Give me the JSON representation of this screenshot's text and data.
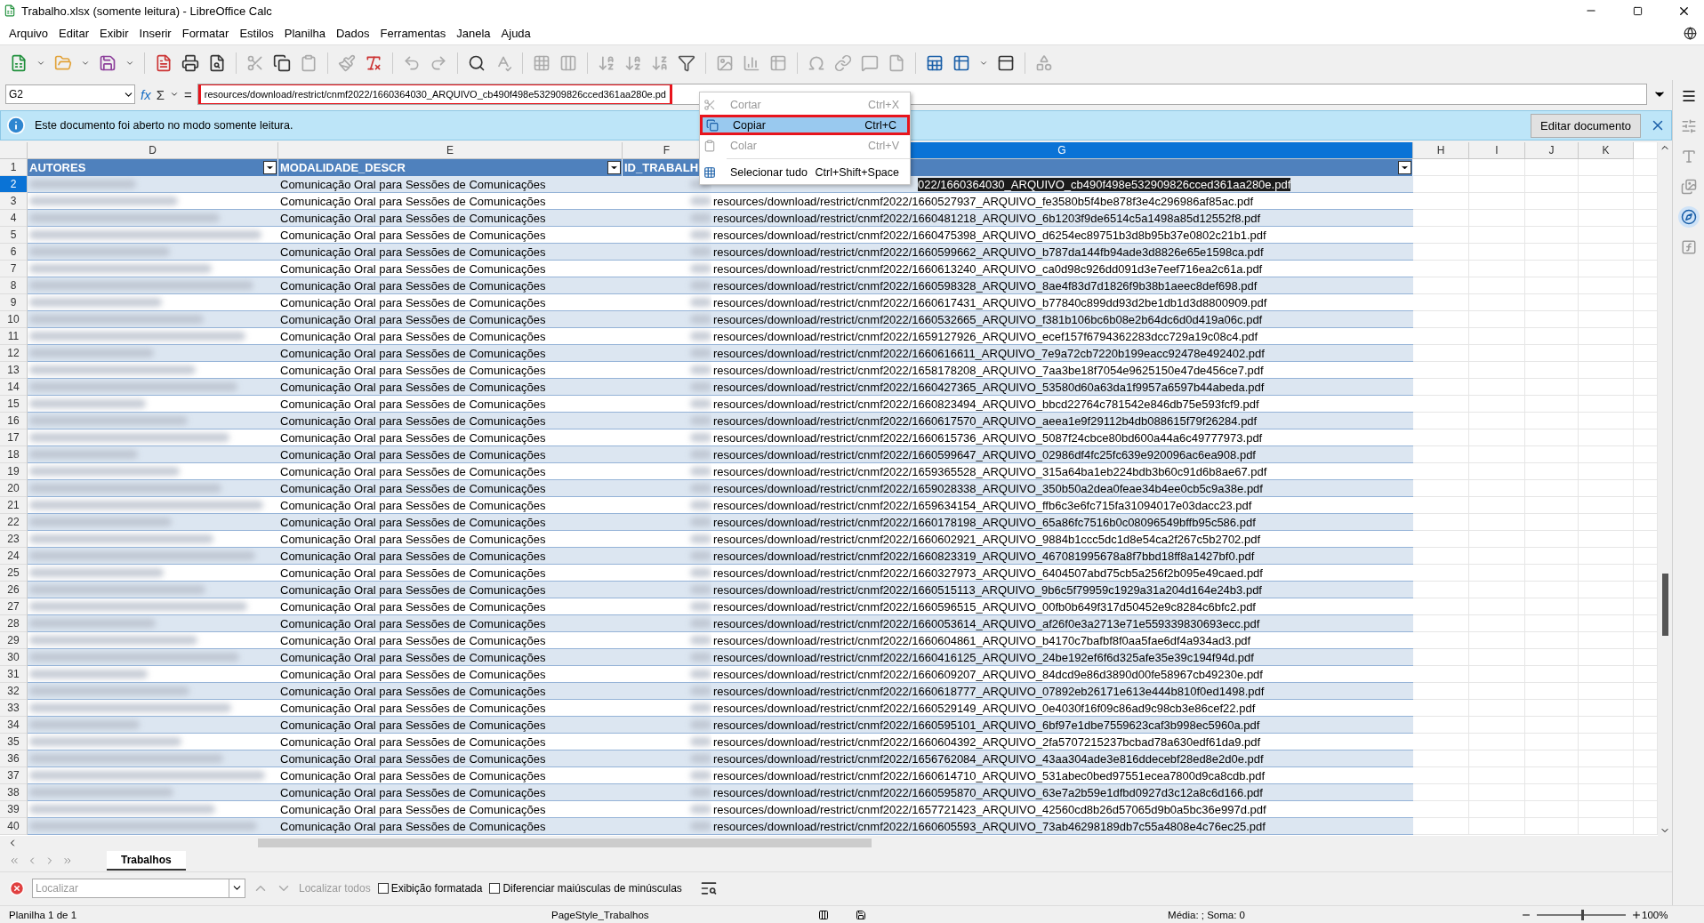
{
  "window": {
    "title": "Trabalho.xlsx (somente leitura) - LibreOffice Calc"
  },
  "menu_bar": [
    "Arquivo",
    "Editar",
    "Exibir",
    "Inserir",
    "Formatar",
    "Estilos",
    "Planilha",
    "Dados",
    "Ferramentas",
    "Janela",
    "Ajuda"
  ],
  "formula_bar": {
    "name_box": "G2",
    "function_symbol": "fx",
    "sum_symbol": "Σ",
    "equals_symbol": "=",
    "value": "resources/download/restrict/cnmf2022/1660364030_ARQUIVO_cb490f498e532909826cced361aa280e.pd"
  },
  "info_bar": {
    "message": "Este documento foi aberto no modo somente leitura.",
    "button": "Editar documento"
  },
  "columns": [
    {
      "letter": "D",
      "header": "AUTORES",
      "selected": false
    },
    {
      "letter": "E",
      "header": "MODALIDADE_DESCR",
      "selected": false
    },
    {
      "letter": "F",
      "header": "ID_TRABALH",
      "selected": false
    },
    {
      "letter": "G",
      "selected": true
    },
    {
      "letter": "H",
      "selected": false
    },
    {
      "letter": "I",
      "selected": false
    },
    {
      "letter": "J",
      "selected": false
    },
    {
      "letter": "K",
      "selected": false
    }
  ],
  "header_row_number": "1",
  "rows": [
    {
      "number": "2",
      "selected": true,
      "modalidade": "Comunicação Oral para Sessões de Comunicações",
      "arquivo": "022/1660364030_ARQUIVO_cb490f498e532909826cced361aa280e.pdf"
    },
    {
      "number": "3",
      "selected": false,
      "modalidade": "Comunicação Oral para Sessões de Comunicações",
      "arquivo": "resources/download/restrict/cnmf2022/1660527937_ARQUIVO_fe3580b5f4be878f3e4c296986af85ac.pdf"
    },
    {
      "number": "4",
      "selected": false,
      "modalidade": "Comunicação Oral para Sessões de Comunicações",
      "arquivo": "resources/download/restrict/cnmf2022/1660481218_ARQUIVO_6b1203f9de6514c5a1498a85d12552f8.pdf"
    },
    {
      "number": "5",
      "selected": false,
      "modalidade": "Comunicação Oral para Sessões de Comunicações",
      "arquivo": "resources/download/restrict/cnmf2022/1660475398_ARQUIVO_d6254ec89751b3d8b95b37e0802c21b1.pdf"
    },
    {
      "number": "6",
      "selected": false,
      "modalidade": "Comunicação Oral para Sessões de Comunicações",
      "arquivo": "resources/download/restrict/cnmf2022/1660599662_ARQUIVO_b787da144fb94ade3d8826e65e1598ca.pdf"
    },
    {
      "number": "7",
      "selected": false,
      "modalidade": "Comunicação Oral para Sessões de Comunicações",
      "arquivo": "resources/download/restrict/cnmf2022/1660613240_ARQUIVO_ca0d98c926dd091d3e7eef716ea2c61a.pdf"
    },
    {
      "number": "8",
      "selected": false,
      "modalidade": "Comunicação Oral para Sessões de Comunicações",
      "arquivo": "resources/download/restrict/cnmf2022/1660598328_ARQUIVO_8ae4f83d7d1826f9b38b1aeec8def698.pdf"
    },
    {
      "number": "9",
      "selected": false,
      "modalidade": "Comunicação Oral para Sessões de Comunicações",
      "arquivo": "resources/download/restrict/cnmf2022/1660617431_ARQUIVO_b77840c899dd93d2be1db1d3d8800909.pdf"
    },
    {
      "number": "10",
      "selected": false,
      "modalidade": "Comunicação Oral para Sessões de Comunicações",
      "arquivo": "resources/download/restrict/cnmf2022/1660532665_ARQUIVO_f381b106bc6b08e2b64dc6d0d419a06c.pdf"
    },
    {
      "number": "11",
      "selected": false,
      "modalidade": "Comunicação Oral para Sessões de Comunicações",
      "arquivo": "resources/download/restrict/cnmf2022/1659127926_ARQUIVO_ecef157f6794362283dcc729a19c08c4.pdf"
    },
    {
      "number": "12",
      "selected": false,
      "modalidade": "Comunicação Oral para Sessões de Comunicações",
      "arquivo": "resources/download/restrict/cnmf2022/1660616611_ARQUIVO_7e9a72cb7220b199eacc92478e492402.pdf"
    },
    {
      "number": "13",
      "selected": false,
      "modalidade": "Comunicação Oral para Sessões de Comunicações",
      "arquivo": "resources/download/restrict/cnmf2022/1658178208_ARQUIVO_7aa3be18f7054e9625150e47de456ce7.pdf"
    },
    {
      "number": "14",
      "selected": false,
      "modalidade": "Comunicação Oral para Sessões de Comunicações",
      "arquivo": "resources/download/restrict/cnmf2022/1660427365_ARQUIVO_53580d60a63da1f9957a6597b44abeda.pdf"
    },
    {
      "number": "15",
      "selected": false,
      "modalidade": "Comunicação Oral para Sessões de Comunicações",
      "arquivo": "resources/download/restrict/cnmf2022/1660823494_ARQUIVO_bbcd22764c781542e846db75e593fcf9.pdf"
    },
    {
      "number": "16",
      "selected": false,
      "modalidade": "Comunicação Oral para Sessões de Comunicações",
      "arquivo": "resources/download/restrict/cnmf2022/1660617570_ARQUIVO_aeea1e9f29112b4db088615f79f26284.pdf"
    },
    {
      "number": "17",
      "selected": false,
      "modalidade": "Comunicação Oral para Sessões de Comunicações",
      "arquivo": "resources/download/restrict/cnmf2022/1660615736_ARQUIVO_5087f24cbce80bd600a44a6c49777973.pdf"
    },
    {
      "number": "18",
      "selected": false,
      "modalidade": "Comunicação Oral para Sessões de Comunicações",
      "arquivo": "resources/download/restrict/cnmf2022/1660599647_ARQUIVO_02986df4fc25fc639e920096ac6ea908.pdf"
    },
    {
      "number": "19",
      "selected": false,
      "modalidade": "Comunicação Oral para Sessões de Comunicações",
      "arquivo": "resources/download/restrict/cnmf2022/1659365528_ARQUIVO_315a64ba1eb224bdb3b60c91d6b8ae67.pdf"
    },
    {
      "number": "20",
      "selected": false,
      "modalidade": "Comunicação Oral para Sessões de Comunicações",
      "arquivo": "resources/download/restrict/cnmf2022/1659028338_ARQUIVO_350b50a2dea0feae34b4ee0cb5c9a38e.pdf"
    },
    {
      "number": "21",
      "selected": false,
      "modalidade": "Comunicação Oral para Sessões de Comunicações",
      "arquivo": "resources/download/restrict/cnmf2022/1659634154_ARQUIVO_ffb6c3e6fc715fa31094017e03dacc23.pdf"
    },
    {
      "number": "22",
      "selected": false,
      "modalidade": "Comunicação Oral para Sessões de Comunicações",
      "arquivo": "resources/download/restrict/cnmf2022/1660178198_ARQUIVO_65a86fc7516b0c08096549bffb95c586.pdf"
    },
    {
      "number": "23",
      "selected": false,
      "modalidade": "Comunicação Oral para Sessões de Comunicações",
      "arquivo": "resources/download/restrict/cnmf2022/1660602921_ARQUIVO_9884b1ccc5dc1d8e54ca2f267c5b2702.pdf"
    },
    {
      "number": "24",
      "selected": false,
      "modalidade": "Comunicação Oral para Sessões de Comunicações",
      "arquivo": "resources/download/restrict/cnmf2022/1660823319_ARQUIVO_467081995678a8f7bbd18ff8a1427bf0.pdf"
    },
    {
      "number": "25",
      "selected": false,
      "modalidade": "Comunicação Oral para Sessões de Comunicações",
      "arquivo": "resources/download/restrict/cnmf2022/1660327973_ARQUIVO_6404507abd75cb5a256f2b095e49caed.pdf"
    },
    {
      "number": "26",
      "selected": false,
      "modalidade": "Comunicação Oral para Sessões de Comunicações",
      "arquivo": "resources/download/restrict/cnmf2022/1660515113_ARQUIVO_9b6c5f79959c1929a31a204d164e24b3.pdf"
    },
    {
      "number": "27",
      "selected": false,
      "modalidade": "Comunicação Oral para Sessões de Comunicações",
      "arquivo": "resources/download/restrict/cnmf2022/1660596515_ARQUIVO_00fb0b649f317d50452e9c8284c6bfc2.pdf"
    },
    {
      "number": "28",
      "selected": false,
      "modalidade": "Comunicação Oral para Sessões de Comunicações",
      "arquivo": "resources/download/restrict/cnmf2022/1660053614_ARQUIVO_af26f0e3a2713e71e559339830693ecc.pdf"
    },
    {
      "number": "29",
      "selected": false,
      "modalidade": "Comunicação Oral para Sessões de Comunicações",
      "arquivo": "resources/download/restrict/cnmf2022/1660604861_ARQUIVO_b4170c7bafbf8f0aa5fae6df4a934ad3.pdf"
    },
    {
      "number": "30",
      "selected": false,
      "modalidade": "Comunicação Oral para Sessões de Comunicações",
      "arquivo": "resources/download/restrict/cnmf2022/1660416125_ARQUIVO_24be192ef6f6d325afe35e39c194f94d.pdf"
    },
    {
      "number": "31",
      "selected": false,
      "modalidade": "Comunicação Oral para Sessões de Comunicações",
      "arquivo": "resources/download/restrict/cnmf2022/1660609207_ARQUIVO_84dcd9e86d3890d00fe58967cb49230e.pdf"
    },
    {
      "number": "32",
      "selected": false,
      "modalidade": "Comunicação Oral para Sessões de Comunicações",
      "arquivo": "resources/download/restrict/cnmf2022/1660618777_ARQUIVO_07892eb26171e613e444b810f0ed1498.pdf"
    },
    {
      "number": "33",
      "selected": false,
      "modalidade": "Comunicação Oral para Sessões de Comunicações",
      "arquivo": "resources/download/restrict/cnmf2022/1660529149_ARQUIVO_0e4030f16f09c86ad9c98cb3e86cef22.pdf"
    },
    {
      "number": "34",
      "selected": false,
      "modalidade": "Comunicação Oral para Sessões de Comunicações",
      "arquivo": "resources/download/restrict/cnmf2022/1660595101_ARQUIVO_6bf97e1dbe7559623caf3b998ec5960a.pdf"
    },
    {
      "number": "35",
      "selected": false,
      "modalidade": "Comunicação Oral para Sessões de Comunicações",
      "arquivo": "resources/download/restrict/cnmf2022/1660604392_ARQUIVO_2fa5707215237bcbad78a630edf61da9.pdf"
    },
    {
      "number": "36",
      "selected": false,
      "modalidade": "Comunicação Oral para Sessões de Comunicações",
      "arquivo": "resources/download/restrict/cnmf2022/1656762084_ARQUIVO_43aa304ade3e816ddecebf28ed8e2d0e.pdf"
    },
    {
      "number": "37",
      "selected": false,
      "modalidade": "Comunicação Oral para Sessões de Comunicações",
      "arquivo": "resources/download/restrict/cnmf2022/1660614710_ARQUIVO_531abec0bed97551ecea7800d9ca8cdb.pdf"
    },
    {
      "number": "38",
      "selected": false,
      "modalidade": "Comunicação Oral para Sessões de Comunicações",
      "arquivo": "resources/download/restrict/cnmf2022/1660595870_ARQUIVO_63e7a2b59e1dfbd0927d3c12a8c6d166.pdf"
    },
    {
      "number": "39",
      "selected": false,
      "modalidade": "Comunicação Oral para Sessões de Comunicações",
      "arquivo": "resources/download/restrict/cnmf2022/1657721423_ARQUIVO_42560cd8b26d57065d9b0a5bc36e997d.pdf"
    },
    {
      "number": "40",
      "selected": false,
      "modalidade": "Comunicação Oral para Sessões de Comunicações",
      "arquivo": "resources/download/restrict/cnmf2022/1660605593_ARQUIVO_73ab46298189db7c55a4808e4c76ec25.pdf"
    }
  ],
  "context_menu": [
    {
      "label": "Cortar",
      "shortcut": "Ctrl+X",
      "disabled": true,
      "highlighted": false,
      "annotated": false
    },
    {
      "label": "Copiar",
      "shortcut": "Ctrl+C",
      "disabled": false,
      "highlighted": true,
      "annotated": true
    },
    {
      "label": "Colar",
      "shortcut": "Ctrl+V",
      "disabled": true,
      "highlighted": false,
      "annotated": false
    },
    {
      "label": "Selecionar tudo",
      "shortcut": "Ctrl+Shift+Space",
      "disabled": false,
      "highlighted": false,
      "annotated": false
    }
  ],
  "sheet_tabs": [
    {
      "label": "Trabalhos",
      "selected": true
    }
  ],
  "find_bar": {
    "placeholder": "Localizar",
    "find_all": "Localizar todos",
    "options": [
      {
        "label": "Exibição formatada",
        "checked": false
      },
      {
        "label": "Diferenciar maiúsculas de minúsculas",
        "checked": false
      }
    ]
  },
  "status_bar": {
    "sheet": "Planilha 1 de 1",
    "page_style": "PageStyle_Trabalhos",
    "summary": "Média: ; Soma: 0",
    "zoom": {
      "level": 0.5,
      "reading": "100%"
    }
  }
}
